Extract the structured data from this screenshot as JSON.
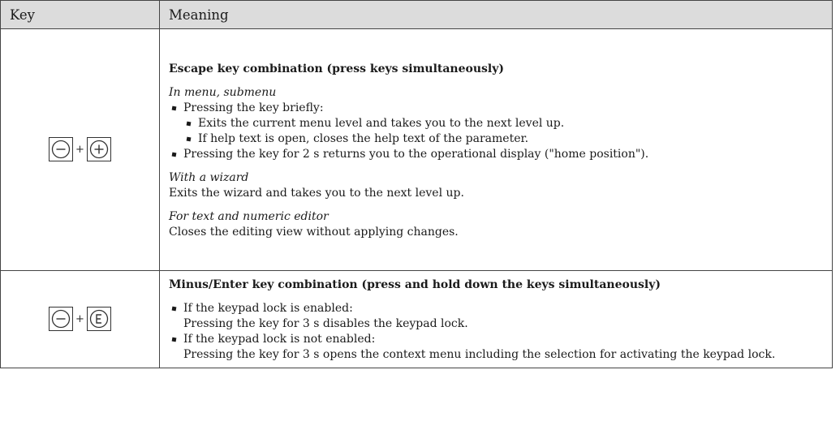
{
  "table": {
    "headers": {
      "key": "Key",
      "meaning": "Meaning"
    },
    "rows": [
      {
        "keys": [
          "minus",
          "plus"
        ],
        "separator": "+",
        "heading": "Escape key combination (press keys simultaneously)",
        "sections": [
          {
            "subheading": "In menu, submenu",
            "item1": "Pressing the key briefly:",
            "item1_sub1": "Exits the current menu level and takes you to the next level up.",
            "item1_sub2": "If help text is open, closes the help text of the parameter.",
            "item2": "Pressing the key for 2 s returns you to the operational display (\"home position\")."
          },
          {
            "subheading": "With a wizard",
            "text": "Exits the wizard and takes you to the next level up."
          },
          {
            "subheading": "For text and numeric editor",
            "text": "Closes the editing view without applying changes."
          }
        ]
      },
      {
        "keys": [
          "minus",
          "E"
        ],
        "separator": "+",
        "heading": "Minus/Enter key combination (press and hold down the keys simultaneously)",
        "item1_line1": "If the keypad lock is enabled:",
        "item1_line2": "Pressing the key for 3 s disables the keypad lock.",
        "item2_line1": "If the keypad lock is not enabled:",
        "item2_line2": "Pressing the key for 3 s opens the context menu including the selection for activating the keypad lock."
      }
    ]
  },
  "icons": {
    "minus": "minus-circle-key-icon",
    "plus": "plus-circle-key-icon",
    "enter": "e-circle-key-icon"
  }
}
